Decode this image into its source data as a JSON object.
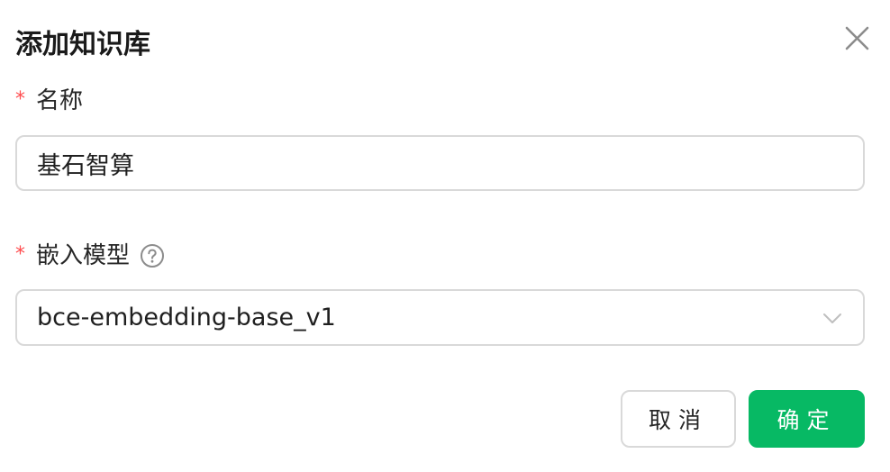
{
  "dialog": {
    "title": "添加知识库"
  },
  "fields": {
    "name": {
      "label": "名称",
      "required_mark": "*",
      "value": "基石智算"
    },
    "embedding_model": {
      "label": "嵌入模型",
      "required_mark": "*",
      "selected": "bce-embedding-base_v1"
    }
  },
  "actions": {
    "cancel_label": "取消",
    "ok_label": "确定"
  },
  "colors": {
    "primary": "#07b964",
    "required": "#ff4d4f",
    "border": "#d9d9d9"
  },
  "icons": {
    "close": "close-icon",
    "help": "question-circle-icon",
    "dropdown": "chevron-down-icon"
  }
}
